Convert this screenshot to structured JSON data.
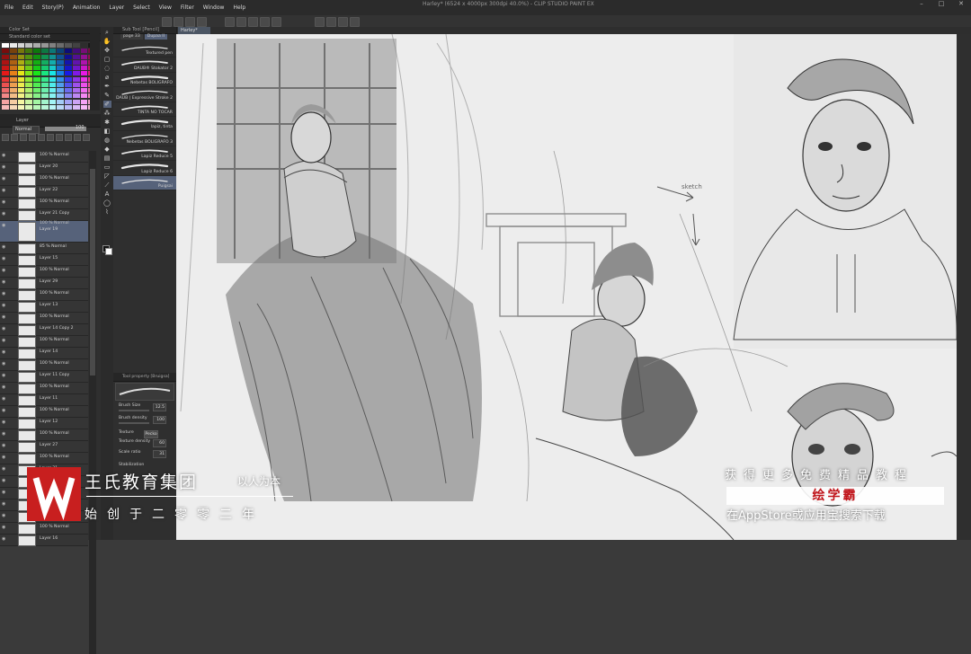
{
  "app": {
    "title_bar": "Harley* (6524 x 4000px 300dpi 40.0%) - CLIP STUDIO PAINT EX",
    "document_tab": "Harley*"
  },
  "menu": [
    "File",
    "Edit",
    "Story(P)",
    "Animation",
    "Layer",
    "Select",
    "View",
    "Filter",
    "Window",
    "Help"
  ],
  "color_set": {
    "tabs": [
      "Color Set"
    ],
    "set_name": "Standard color set"
  },
  "layer_panel": {
    "tab": "Layer",
    "blend_mode": "Normal",
    "opacity": "100",
    "layers": [
      {
        "top": "",
        "name": "100 % Normal",
        "sel": false,
        "tall": false
      },
      {
        "top": "",
        "name": "Layer 20",
        "sel": false,
        "tall": false
      },
      {
        "top": "",
        "name": "100 % Normal",
        "sel": false,
        "tall": false
      },
      {
        "top": "",
        "name": "Layer 22",
        "sel": false,
        "tall": false
      },
      {
        "top": "",
        "name": "100 % Normal",
        "sel": false,
        "tall": false
      },
      {
        "top": "",
        "name": "Layer 21 Copy",
        "sel": false,
        "tall": false
      },
      {
        "top": "100 % Normal",
        "name": "Layer 19",
        "sel": true,
        "tall": true
      },
      {
        "top": "",
        "name": "85 % Normal",
        "sel": false,
        "tall": false
      },
      {
        "top": "",
        "name": "Layer 15",
        "sel": false,
        "tall": false
      },
      {
        "top": "",
        "name": "100 % Normal",
        "sel": false,
        "tall": false
      },
      {
        "top": "",
        "name": "Layer 29",
        "sel": false,
        "tall": false
      },
      {
        "top": "",
        "name": "100 % Normal",
        "sel": false,
        "tall": false
      },
      {
        "top": "",
        "name": "Layer 13",
        "sel": false,
        "tall": false
      },
      {
        "top": "",
        "name": "100 % Normal",
        "sel": false,
        "tall": false
      },
      {
        "top": "",
        "name": "Layer 14 Copy 2",
        "sel": false,
        "tall": false
      },
      {
        "top": "",
        "name": "100 % Normal",
        "sel": false,
        "tall": false
      },
      {
        "top": "",
        "name": "Layer 14",
        "sel": false,
        "tall": false
      },
      {
        "top": "",
        "name": "100 % Normal",
        "sel": false,
        "tall": false
      },
      {
        "top": "",
        "name": "Layer 11 Copy",
        "sel": false,
        "tall": false
      },
      {
        "top": "",
        "name": "100 % Normal",
        "sel": false,
        "tall": false
      },
      {
        "top": "",
        "name": "Layer 11",
        "sel": false,
        "tall": false
      },
      {
        "top": "",
        "name": "100 % Normal",
        "sel": false,
        "tall": false
      },
      {
        "top": "",
        "name": "Layer 12",
        "sel": false,
        "tall": false
      },
      {
        "top": "",
        "name": "100 % Normal",
        "sel": false,
        "tall": false
      },
      {
        "top": "",
        "name": "Layer 27",
        "sel": false,
        "tall": false
      },
      {
        "top": "",
        "name": "100 % Normal",
        "sel": false,
        "tall": false
      },
      {
        "top": "",
        "name": "Layer 31",
        "sel": false,
        "tall": false
      },
      {
        "top": "",
        "name": "100 % Normal",
        "sel": false,
        "tall": false
      },
      {
        "top": "",
        "name": "",
        "sel": false,
        "tall": false
      },
      {
        "top": "",
        "name": "",
        "sel": false,
        "tall": false
      },
      {
        "top": "",
        "name": "",
        "sel": false,
        "tall": false
      },
      {
        "top": "",
        "name": "100 % Normal",
        "sel": false,
        "tall": false
      },
      {
        "top": "",
        "name": "Layer 16",
        "sel": false,
        "tall": false
      }
    ]
  },
  "brush_panel": {
    "tabs": [
      "page 33",
      "Dupaa II"
    ],
    "header": "Sub Tool [Pencil]",
    "brushes": [
      "Textured pen",
      "DAUB® Stokator 2",
      "Nebetas BOLIGRAFO",
      "DAUB | Expressive Stroke 2",
      "TINTA NO TOCAR",
      "lapiz, tinta",
      "Nebetas BOLIGRAFO 3",
      "Lapiz Reduce 5",
      "Lapiz Reduce 6",
      "Puigsai"
    ],
    "selected_index": 9
  },
  "tool_property": {
    "header": "Tool property [Bruigsa]",
    "brush_size": {
      "label": "Brush Size",
      "value": "12.5"
    },
    "brush_density": {
      "label": "Brush density",
      "value": "100"
    },
    "texture": {
      "label": "Texture",
      "value": "Pecko"
    },
    "texture_density": {
      "label": "Texture density",
      "value": "60"
    },
    "scale_ratio": {
      "label": "Scale ratio",
      "value": "31"
    },
    "stabilization": {
      "label": "Stabilization"
    }
  },
  "overlay": {
    "company": "王氏教育集团",
    "slogan": "以人为本",
    "founded": "始创于二零零二年",
    "promo_top": "获得更多免费精品教程",
    "promo_app": "绘学霸",
    "promo_bottom": "在AppStore或应用宝搜索下载"
  },
  "colors": {
    "accent": "#56627a",
    "logo_red": "#c81f1f",
    "promo_red": "#c0141a"
  }
}
